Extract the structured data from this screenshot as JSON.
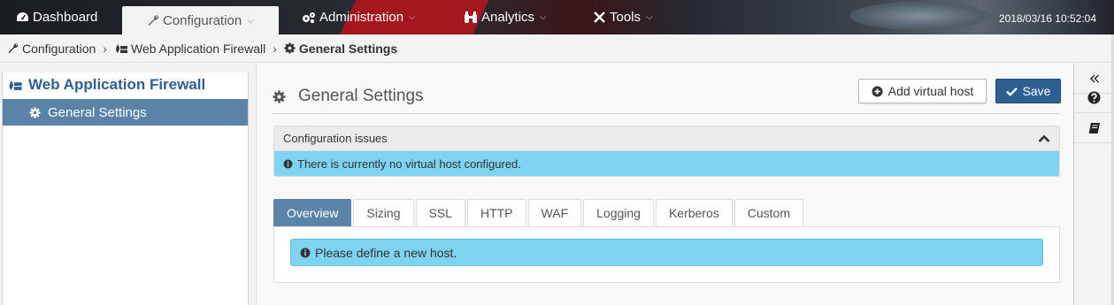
{
  "nav": {
    "items": [
      {
        "label": "Dashboard",
        "icon": "dashboard-icon"
      },
      {
        "label": "Configuration",
        "icon": "wrench-icon",
        "active": true
      },
      {
        "label": "Administration",
        "icon": "gears-icon"
      },
      {
        "label": "Analytics",
        "icon": "binoculars-icon"
      },
      {
        "label": "Tools",
        "icon": "tools-icon"
      }
    ],
    "clock": "2018/03/16 10:52:04"
  },
  "breadcrumb": {
    "items": [
      "Configuration",
      "Web Application Firewall",
      "General Settings"
    ],
    "separator": "›"
  },
  "sidebar": {
    "title": "Web Application Firewall",
    "items": [
      {
        "label": "General Settings",
        "selected": true
      }
    ]
  },
  "main": {
    "title": "General Settings",
    "add_button": "Add virtual host",
    "save_button": "Save",
    "issues": {
      "header": "Configuration issues",
      "message": "There is currently no virtual host configured."
    },
    "tabs": [
      {
        "label": "Overview",
        "active": true
      },
      {
        "label": "Sizing"
      },
      {
        "label": "SSL"
      },
      {
        "label": "HTTP"
      },
      {
        "label": "WAF"
      },
      {
        "label": "Logging"
      },
      {
        "label": "Kerberos"
      },
      {
        "label": "Custom"
      }
    ],
    "tab_message": "Please define a new host."
  },
  "colors": {
    "accent": "#2d5f91",
    "selected": "#5b83a8",
    "info": "#7dd3f0"
  }
}
